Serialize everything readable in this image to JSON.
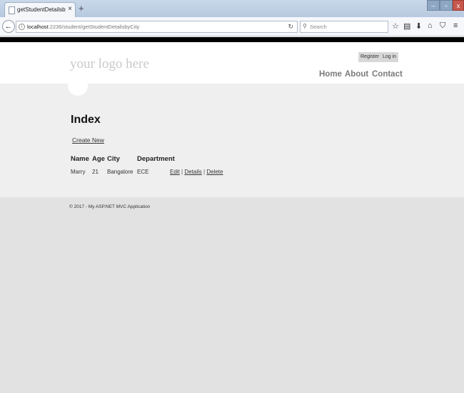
{
  "browser": {
    "tab_title": "getStudentDetailsbyCity - My",
    "tab_close": "×",
    "new_tab": "+",
    "url_host": "localhost",
    "url_rest": ":2236/student/getStudentDetailsbyCity",
    "search_placeholder": "Search",
    "window_controls": {
      "min": "–",
      "max": "▫",
      "close": "x"
    }
  },
  "header": {
    "logo": "your logo here",
    "register": "Register",
    "login": "Log in",
    "nav": [
      "Home",
      "About",
      "Contact"
    ]
  },
  "main": {
    "title": "Index",
    "create_new": "Create New",
    "columns": [
      "Name",
      "Age",
      "City",
      "Department"
    ],
    "rows": [
      {
        "name": "Marry",
        "age": "21",
        "city": "Bangalore",
        "department": "ECE",
        "actions": [
          "Edit",
          "Details",
          "Delete"
        ]
      }
    ],
    "separator": "|"
  },
  "footer": {
    "text": "© 2017 - My ASP.NET MVC Application"
  }
}
